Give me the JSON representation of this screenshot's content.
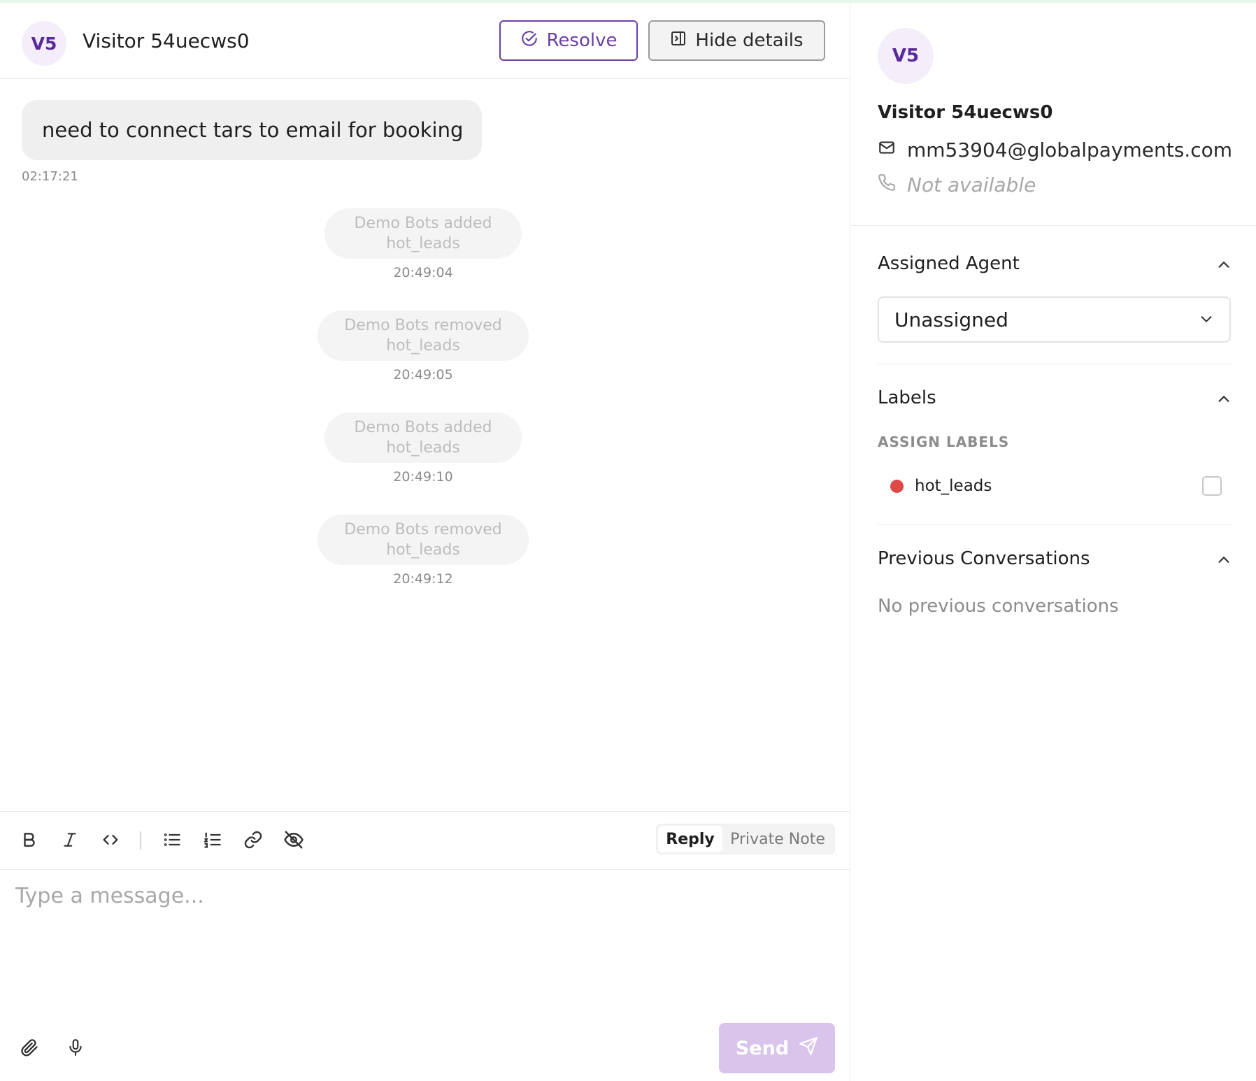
{
  "header": {
    "avatar_initials": "V5",
    "visitor_name": "Visitor 54uecws0",
    "resolve_label": "Resolve",
    "hide_details_label": "Hide details"
  },
  "messages": [
    {
      "text": "need to connect tars to email for booking",
      "time": "02:17:21"
    }
  ],
  "system_events": [
    {
      "text": "Demo Bots added hot_leads",
      "time": "20:49:04"
    },
    {
      "text": "Demo Bots removed hot_leads",
      "time": "20:49:05"
    },
    {
      "text": "Demo Bots added hot_leads",
      "time": "20:49:10"
    },
    {
      "text": "Demo Bots removed hot_leads",
      "time": "20:49:12"
    }
  ],
  "composer": {
    "mode_reply": "Reply",
    "mode_private_note": "Private Note",
    "active_mode": "Reply",
    "placeholder": "Type a message...",
    "value": "",
    "send_label": "Send",
    "toolbar_icons": [
      "bold-icon",
      "italic-icon",
      "code-icon",
      "bullet-list-icon",
      "numbered-list-icon",
      "link-icon",
      "eye-off-icon"
    ]
  },
  "details": {
    "avatar_initials": "V5",
    "name": "Visitor 54uecws0",
    "email": "mm53904@globalpayments.com",
    "phone": "Not available",
    "assigned_agent_title": "Assigned Agent",
    "assigned_agent_value": "Unassigned",
    "labels_title": "Labels",
    "assign_labels_caption": "ASSIGN LABELS",
    "labels": [
      {
        "name": "hot_leads",
        "color": "#e04848",
        "checked": false
      }
    ],
    "previous_title": "Previous Conversations",
    "previous_empty": "No previous conversations"
  },
  "colors": {
    "accent": "#6b3fa8",
    "avatar_bg": "#f4eefb",
    "send_disabled": "#d9c4ec"
  }
}
